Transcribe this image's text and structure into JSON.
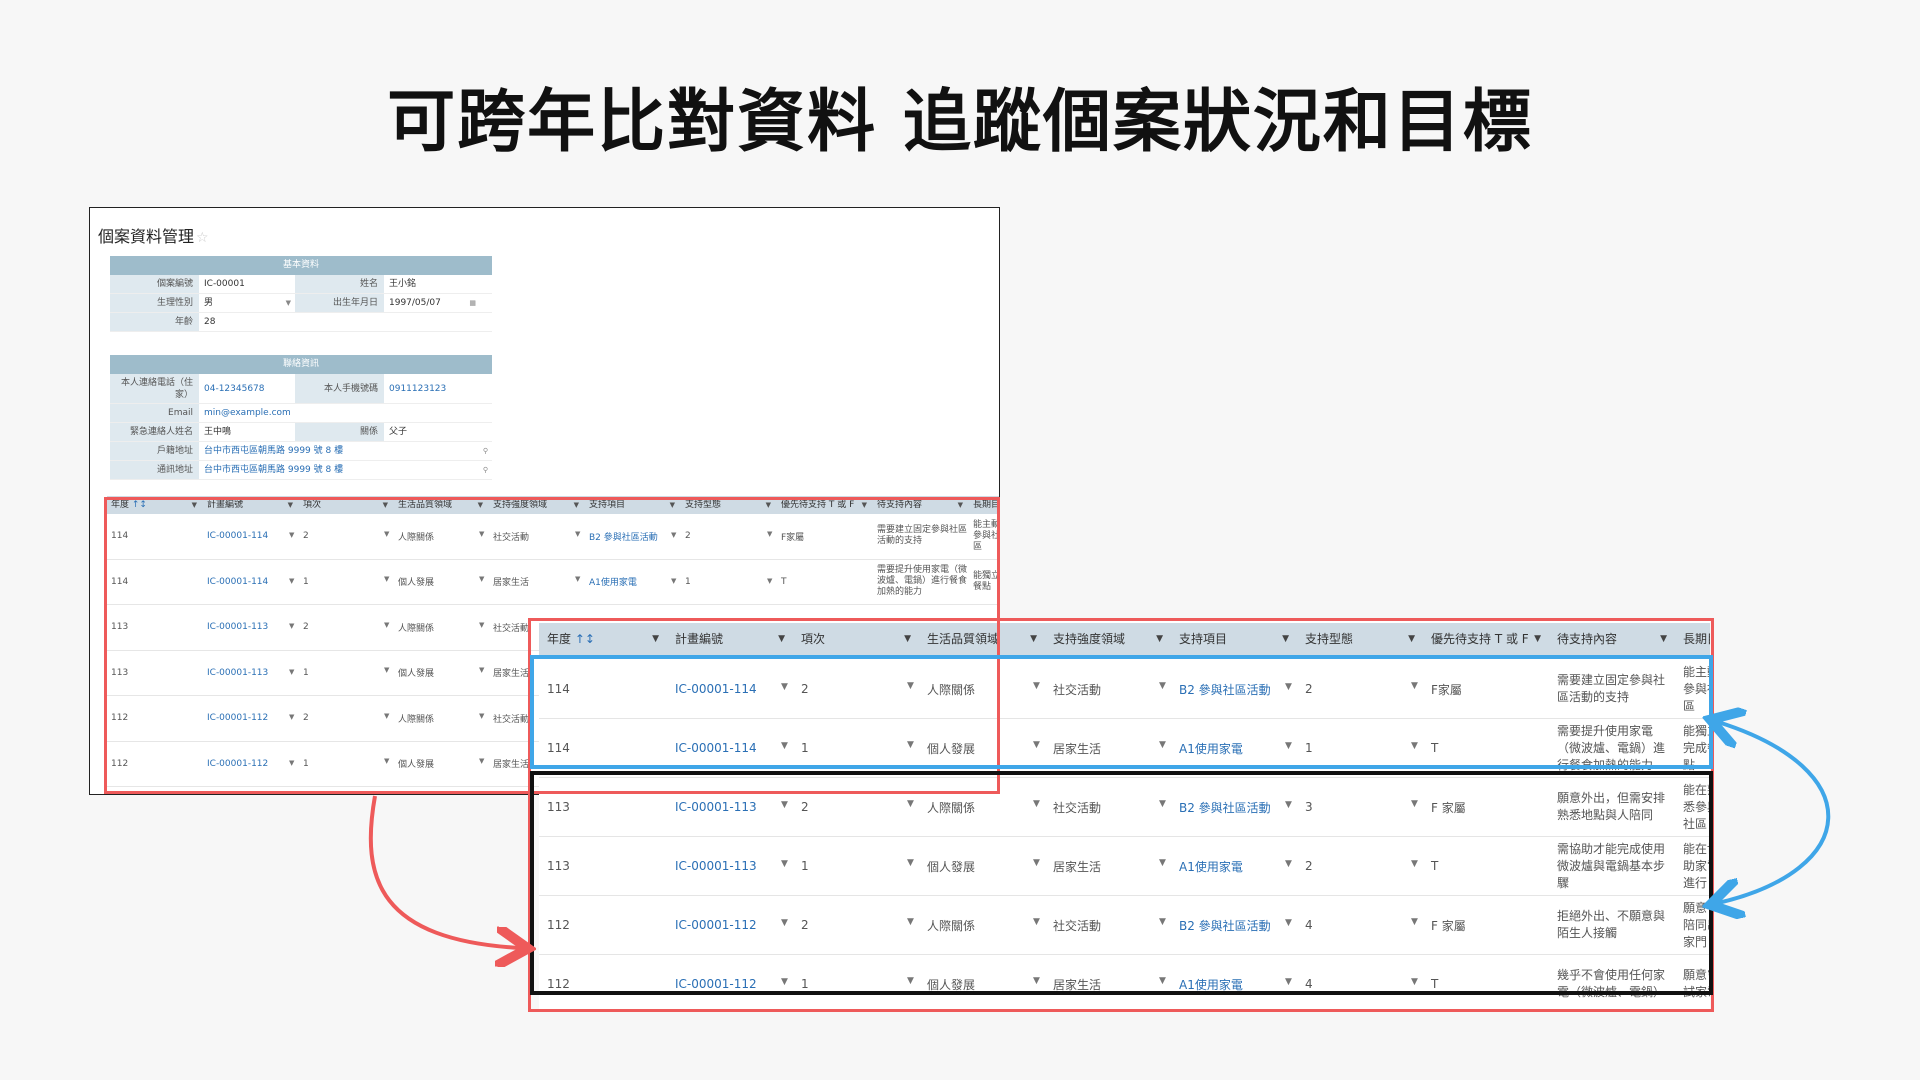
{
  "headline": "可跨年比對資料 追蹤個案狀況和目標",
  "app": {
    "title": "個案資料管理"
  },
  "basic": {
    "header": "基本資料",
    "case_no_label": "個案編號",
    "case_no": "IC-00001",
    "name_label": "姓名",
    "name": "王小銘",
    "sex_label": "生理性別",
    "sex": "男",
    "birth_label": "出生年月日",
    "birth": "1997/05/07",
    "age_label": "年齡",
    "age": "28"
  },
  "contact": {
    "header": "聯絡資訊",
    "home_phone_label": "本人連絡電話（住家）",
    "home_phone": "04-12345678",
    "mobile_label": "本人手機號碼",
    "mobile": "0911123123",
    "email_label": "Email",
    "email": "min@example.com",
    "emergency_label": "緊急連絡人姓名",
    "emergency": "王中鳴",
    "relation_label": "關係",
    "relation": "父子",
    "reg_addr_label": "戶籍地址",
    "reg_addr": "台中市西屯區朝馬路 9999 號 8 樓",
    "mail_addr_label": "通訊地址",
    "mail_addr": "台中市西屯區朝馬路 9999 號 8 樓"
  },
  "table": {
    "columns": [
      "年度",
      "計畫編號",
      "項次",
      "生活品質領域",
      "支持強度領域",
      "支持項目",
      "支持型態",
      "優先待支持 T 或 F",
      "待支持內容",
      "長期目標"
    ],
    "sort_icon": "↑↕",
    "rows": [
      {
        "year": "114",
        "plan": "IC-00001-114",
        "item": "2",
        "domain": "人際關係",
        "intensity": "社交活動",
        "support": "B2 參與社區活動",
        "type": "2",
        "priority": "F家屬",
        "content": "需要建立固定參與社區活動的支持",
        "goal": "能主動參與社區"
      },
      {
        "year": "114",
        "plan": "IC-00001-114",
        "item": "1",
        "domain": "個人發展",
        "intensity": "居家生活",
        "support": "A1使用家電",
        "type": "1",
        "priority": "T",
        "content": "需要提升使用家電（微波爐、電鍋）進行餐食加熱的能力",
        "goal": "能獨立完成餐點"
      },
      {
        "year": "113",
        "plan": "IC-00001-113",
        "item": "2",
        "domain": "人際關係",
        "intensity": "社交活動",
        "support": "B2 參與社區活動",
        "type": "3",
        "priority": "F 家屬",
        "content": "願意外出，但需安排熟悉地點與人陪同",
        "goal": "能在熟悉參與社區"
      },
      {
        "year": "113",
        "plan": "IC-00001-113",
        "item": "1",
        "domain": "個人發展",
        "intensity": "居家生活",
        "support": "A1使用家電",
        "type": "2",
        "priority": "T",
        "content": "需協助才能完成使用微波爐與電鍋基本步驟",
        "goal": "能在協助家電進行"
      },
      {
        "year": "112",
        "plan": "IC-00001-112",
        "item": "2",
        "domain": "人際關係",
        "intensity": "社交活動",
        "support": "B2 參與社區活動",
        "type": "4",
        "priority": "F 家屬",
        "content": "拒絕外出、不願意與陌生人接觸",
        "goal": "願意在陪同出家門"
      },
      {
        "year": "112",
        "plan": "IC-00001-112",
        "item": "1",
        "domain": "個人發展",
        "intensity": "居家生活",
        "support": "A1使用家電",
        "type": "4",
        "priority": "T",
        "content": "幾乎不會使用任何家電（微波爐、電鍋）",
        "goal": "願意嘗試家電"
      }
    ]
  },
  "small_table_rows": [
    {
      "year": "114",
      "plan": "IC-00001-114",
      "item": "2",
      "domain": "人際關係",
      "intensity": "社交活動",
      "support": "B2 參與社區活動",
      "type": "2",
      "priority": "F家屬",
      "content": "需要建立固定參與社區活動的支持",
      "goal": "能主動參與社區"
    },
    {
      "year": "114",
      "plan": "IC-00001-114",
      "item": "1",
      "domain": "個人發展",
      "intensity": "居家生活",
      "support": "A1使用家電",
      "type": "1",
      "priority": "T",
      "content": "需要提升使用家電（微波爐、電鍋）進行餐食加熱的能力",
      "goal": "能獨立餐點"
    },
    {
      "year": "113",
      "plan": "IC-00001-113",
      "item": "2",
      "domain": "人際關係",
      "intensity": "社交活動"
    },
    {
      "year": "113",
      "plan": "IC-00001-113",
      "item": "1",
      "domain": "個人發展",
      "intensity": "居家生活"
    },
    {
      "year": "112",
      "plan": "IC-00001-112",
      "item": "2",
      "domain": "人際關係",
      "intensity": "社交活動"
    },
    {
      "year": "112",
      "plan": "IC-00001-112",
      "item": "1",
      "domain": "個人發展",
      "intensity": "居家生活"
    }
  ],
  "colors": {
    "red": "#ee5a5a",
    "blue": "#3fa6e8",
    "black": "#111111",
    "header_bg": "#9ebccb",
    "link": "#2a6fb5"
  }
}
